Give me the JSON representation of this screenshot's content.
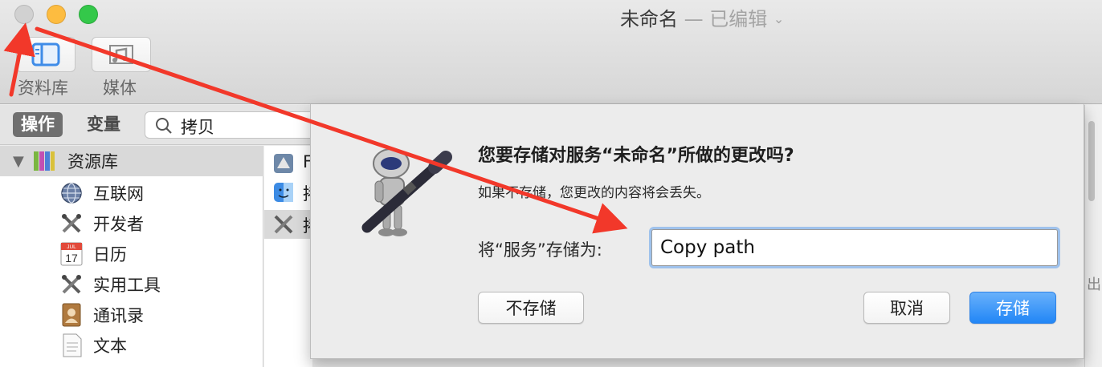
{
  "window": {
    "title": "未命名",
    "title_suffix": " — 已编辑",
    "traffic_lights": [
      "close",
      "minimize",
      "maximize"
    ]
  },
  "toolbar": {
    "library_label": "资料库",
    "media_label": "媒体"
  },
  "filter": {
    "actions_tab": "操作",
    "variables_tab": "变量",
    "search_value": "拷贝"
  },
  "library": {
    "root": "资源库",
    "items": [
      {
        "label": "互联网",
        "icon": "globe-icon"
      },
      {
        "label": "开发者",
        "icon": "tools-icon"
      },
      {
        "label": "日历",
        "icon": "calendar-icon"
      },
      {
        "label": "实用工具",
        "icon": "tools-icon"
      },
      {
        "label": "通讯录",
        "icon": "contacts-icon"
      },
      {
        "label": "文本",
        "icon": "text-icon"
      }
    ],
    "calendar_month": "JUL",
    "calendar_day": "17"
  },
  "actions": {
    "rows": [
      "F",
      "拷",
      "拷"
    ]
  },
  "right_strip": {
    "text": "出"
  },
  "dialog": {
    "question": "您要存储对服务“未命名”所做的更改吗?",
    "body": "如果不存储，您更改的内容将会丢失。",
    "save_as_label": "将“服务”存储为:",
    "name_value": "Copy path",
    "dont_save": "不存储",
    "cancel": "取消",
    "save": "存储"
  },
  "colors": {
    "accent": "#2186f6",
    "annotation_arrow": "#f2382a"
  }
}
